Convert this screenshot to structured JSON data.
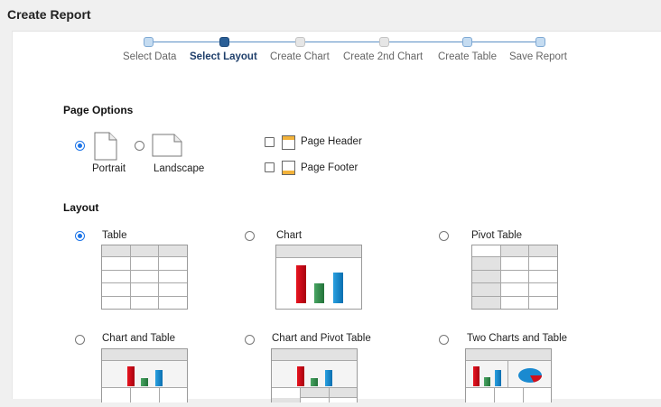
{
  "window": {
    "title": "Create Report"
  },
  "wizard": {
    "steps": [
      {
        "label": "Select Data",
        "state": "done"
      },
      {
        "label": "Select Layout",
        "state": "active"
      },
      {
        "label": "Create Chart",
        "state": "disabled"
      },
      {
        "label": "Create 2nd Chart",
        "state": "disabled"
      },
      {
        "label": "Create Table",
        "state": "done"
      },
      {
        "label": "Save Report",
        "state": "done"
      }
    ]
  },
  "page_options": {
    "heading": "Page Options",
    "orientation": [
      {
        "label": "Portrait",
        "checked": true
      },
      {
        "label": "Landscape",
        "checked": false
      }
    ],
    "checkboxes": [
      {
        "label": "Page Header",
        "checked": false
      },
      {
        "label": "Page Footer",
        "checked": false
      }
    ]
  },
  "layout": {
    "heading": "Layout",
    "options": [
      {
        "label": "Table",
        "checked": true
      },
      {
        "label": "Chart",
        "checked": false
      },
      {
        "label": "Pivot Table",
        "checked": false
      },
      {
        "label": "Chart and Table",
        "checked": false
      },
      {
        "label": "Chart and Pivot Table",
        "checked": false
      },
      {
        "label": "Two Charts and Table",
        "checked": false
      }
    ]
  },
  "colors": {
    "accent": "#1a73e8",
    "wizard_active": "#2b5f96",
    "wizard_done": "#c5dcf1",
    "chart_red": "#d0101c",
    "chart_green": "#3a9150",
    "chart_blue": "#1a8ad0"
  }
}
